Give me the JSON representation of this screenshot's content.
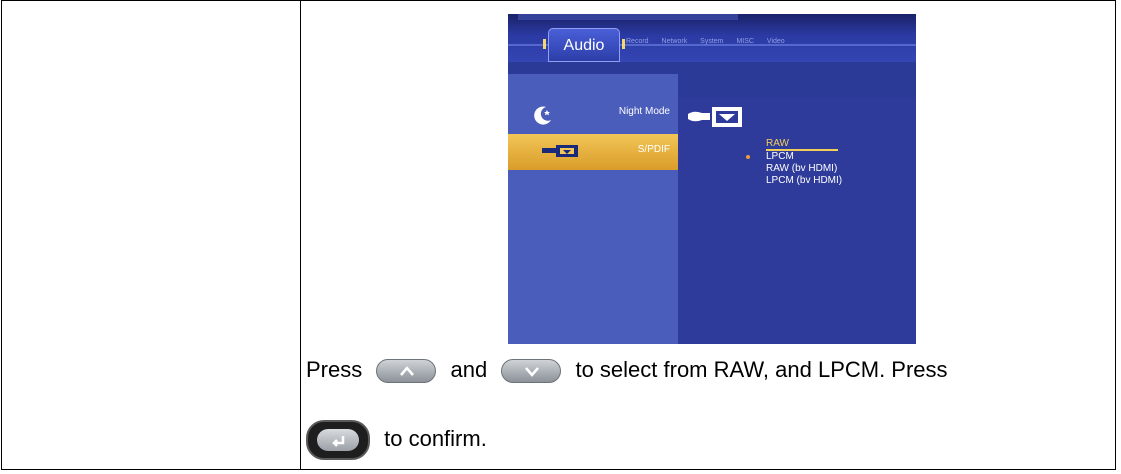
{
  "menu": {
    "active_tab": "Audio",
    "other_tabs": [
      "Record",
      "Network",
      "System",
      "MISC",
      "Video"
    ],
    "left_items": [
      {
        "label": "Night Mode",
        "icon": "moon-icon",
        "selected": false
      },
      {
        "label": "S/PDIF",
        "icon": "spdif-icon",
        "selected": true
      }
    ],
    "options": [
      "RAW",
      "LPCM",
      "RAW (bv HDMI)",
      "LPCM (bv HDMI)"
    ],
    "highlighted_option": "RAW",
    "marked_option": "LPCM",
    "accent_color": "#f3cf5a",
    "background_color": "#2a3a96"
  },
  "instructions": {
    "line1_press": "Press",
    "line1_and": "and",
    "line1_rest": "to select from RAW, and LPCM. Press",
    "line2_rest": "to confirm."
  }
}
